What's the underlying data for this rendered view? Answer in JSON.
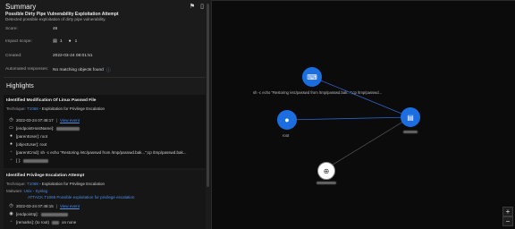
{
  "summary": {
    "title": "Summary",
    "alert_title": "Possible Dirty Pipe Vulnerability Exploitation Attempt",
    "description": "Detected possible exploitation of dirty pipe vulnerability."
  },
  "fields": {
    "score_label": "Score:",
    "score_value": "46",
    "impact_label": "Impact scope:",
    "impact_endpoints": "1",
    "impact_users": "1",
    "created_label": "Created:",
    "created_value": "2022-03-24 08:01:51",
    "responses_label": "Automated responses:",
    "responses_value": "No matching objects found"
  },
  "highlights": {
    "heading": "Highlights",
    "card1": {
      "title": "Identified Modification Of Linux Passwd File",
      "technique_label": "Technique:",
      "technique_id": "T1068",
      "technique_name": " - Exploitation for Privilege Escalation",
      "rows": [
        {
          "time": "2022-03-24 07:48:17",
          "sep": " | ",
          "link": "View event"
        },
        {
          "label": "[endpointHostName]:"
        },
        {
          "label": "[parentUser]: root"
        },
        {
          "label": "[objectUser]: root"
        },
        {
          "label": "[parentCmd]: sh -c echo \"Restoring /etc/passwd from /tmp/passwd.bak...\";cp /tmp/passwd.bak..."
        },
        {
          "label": "[ ]:"
        }
      ]
    },
    "card2": {
      "title": "Identified Privilege Escalation Attempt",
      "technique_label": "Technique:",
      "technique_id": "T1068",
      "technique_name": " - Exploitation for Privilege Escalation",
      "malware_label": "Malware:",
      "malware_value": "Unix - Syslog",
      "malware_detail": "ATTACK.T1068 Possible exploitation for privilege escalation",
      "rows": [
        {
          "time": "2022-03-24 07:48:15",
          "sep": " | ",
          "link": "View event"
        },
        {
          "label": "[endpointIp]:"
        },
        {
          "label": "[remarks]: (to root)",
          "suffix": "on none"
        }
      ]
    }
  },
  "graph": {
    "process_label": "sh -c echo \"Restoring /etc/passwd from /tmp/passwd.bak...\";cp /tmp/passwd...",
    "user_label": "root",
    "host_label": "",
    "ip_label": "",
    "zoom_in": "+",
    "zoom_out": "−",
    "colors": {
      "node": "#1c6ee0",
      "edge": "#2f63c9",
      "ip_edge": "#4a4a4a"
    }
  },
  "icons": {
    "flag": "flag-icon",
    "doc": "document-icon",
    "endpoint": "endpoint-icon",
    "user": "user-icon",
    "info": "info-icon",
    "clock": "clock-icon",
    "host": "host-icon",
    "terminal": "terminal-icon",
    "globe": "globe-icon"
  }
}
